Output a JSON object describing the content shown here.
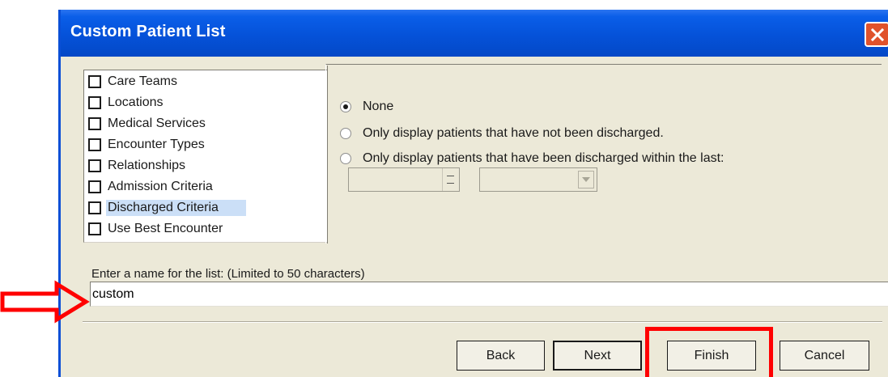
{
  "window": {
    "title": "Custom Patient List"
  },
  "criteria_list": {
    "items": [
      {
        "label": "Care Teams",
        "checked": false,
        "selected": false
      },
      {
        "label": "Locations",
        "checked": false,
        "selected": false
      },
      {
        "label": "Medical Services",
        "checked": false,
        "selected": false
      },
      {
        "label": "Encounter Types",
        "checked": false,
        "selected": false
      },
      {
        "label": "Relationships",
        "checked": false,
        "selected": false
      },
      {
        "label": "Admission Criteria",
        "checked": false,
        "selected": false
      },
      {
        "label": "Discharged Criteria",
        "checked": false,
        "selected": true
      },
      {
        "label": "Use Best Encounter",
        "checked": false,
        "selected": false
      }
    ]
  },
  "discharge_options": {
    "radios": [
      {
        "label": "None",
        "selected": true
      },
      {
        "label": "Only display patients that have not been discharged.",
        "selected": false
      },
      {
        "label": "Only display patients that have been discharged within the last:",
        "selected": false
      }
    ],
    "amount_value": "",
    "unit_value": ""
  },
  "list_name": {
    "label": "Enter a name for the list: (Limited to 50 characters)",
    "value": "custom"
  },
  "buttons": {
    "back": "Back",
    "next": "Next",
    "finish": "Finish",
    "cancel": "Cancel"
  },
  "colors": {
    "title_bar": "#0552d9",
    "dialog_bg": "#ece9d8",
    "selection": "#cbdff7",
    "annotation": "#ff0000"
  },
  "icons": [
    "close-icon",
    "checkbox-icon",
    "radio-icon",
    "spin-up-icon",
    "spin-down-icon",
    "dropdown-arrow-icon",
    "annotation-arrow-icon"
  ]
}
